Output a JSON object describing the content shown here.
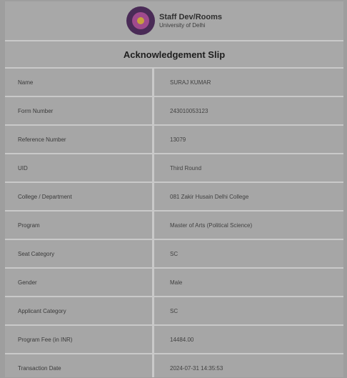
{
  "header": {
    "brand_name": "Staff Dev/Rooms",
    "brand_sub": "University of Delhi"
  },
  "title": "Acknowledgement Slip",
  "rows": [
    {
      "label": "Name",
      "value": "SURAJ KUMAR"
    },
    {
      "label": "Form Number",
      "value": "243010053123"
    },
    {
      "label": "Reference Number",
      "value": "13079"
    },
    {
      "label": "UID",
      "value": "Third Round"
    },
    {
      "label": "College / Department",
      "value": "081 Zakir Husain Delhi College"
    },
    {
      "label": "Program",
      "value": "Master of Arts (Political Science)"
    },
    {
      "label": "Seat Category",
      "value": "SC"
    },
    {
      "label": "Gender",
      "value": "Male"
    },
    {
      "label": "Applicant Category",
      "value": "SC"
    },
    {
      "label": "Program Fee (in INR)",
      "value": "14484.00"
    },
    {
      "label": "Transaction Date",
      "value": "2024-07-31 14:35:53"
    }
  ]
}
